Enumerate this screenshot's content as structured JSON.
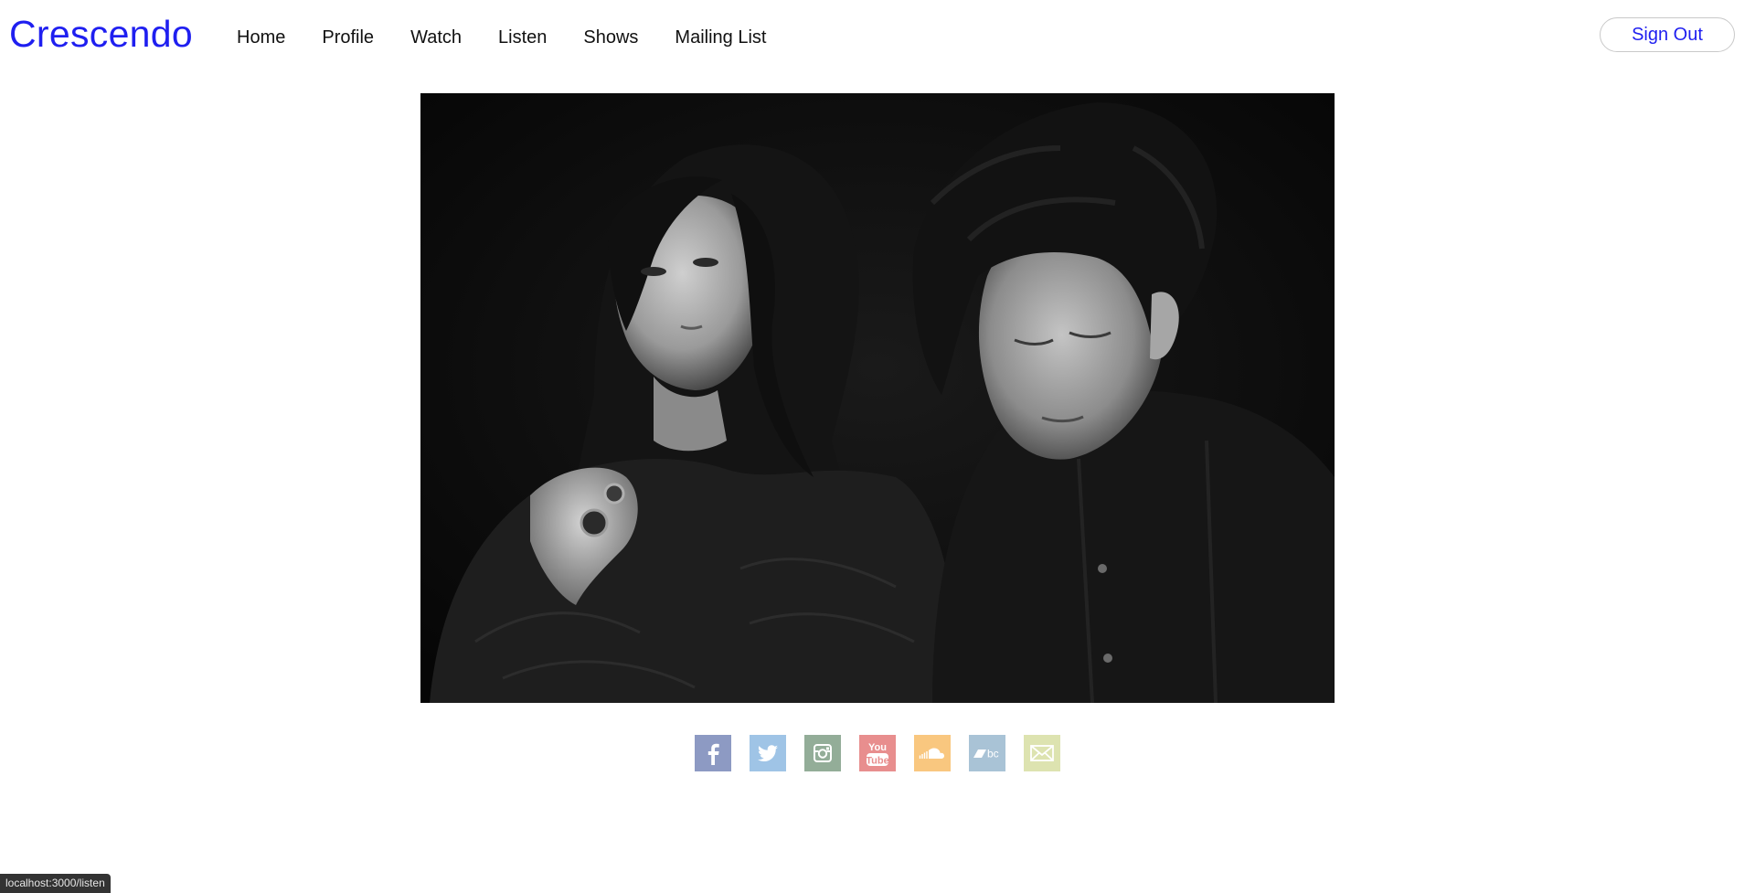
{
  "header": {
    "brand": "Crescendo",
    "nav": [
      {
        "label": "Home"
      },
      {
        "label": "Profile"
      },
      {
        "label": "Watch"
      },
      {
        "label": "Listen"
      },
      {
        "label": "Shows"
      },
      {
        "label": "Mailing List"
      }
    ],
    "sign_out_label": "Sign Out"
  },
  "colors": {
    "brand": "#1f1ff0",
    "facebook": "#8d9ac3",
    "twitter": "#9fc4e6",
    "instagram": "#93ad98",
    "youtube": "#e88e8e",
    "soundcloud": "#f9c77f",
    "bandcamp": "#a9c3d6",
    "email": "#dde3b0"
  },
  "social": [
    {
      "icon": "facebook-icon"
    },
    {
      "icon": "twitter-icon"
    },
    {
      "icon": "instagram-icon"
    },
    {
      "icon": "youtube-icon",
      "text_top": "You",
      "text_bottom": "Tube"
    },
    {
      "icon": "soundcloud-icon"
    },
    {
      "icon": "bandcamp-icon",
      "text": "bc"
    },
    {
      "icon": "email-icon"
    }
  ],
  "status_url": "localhost:3000/listen"
}
